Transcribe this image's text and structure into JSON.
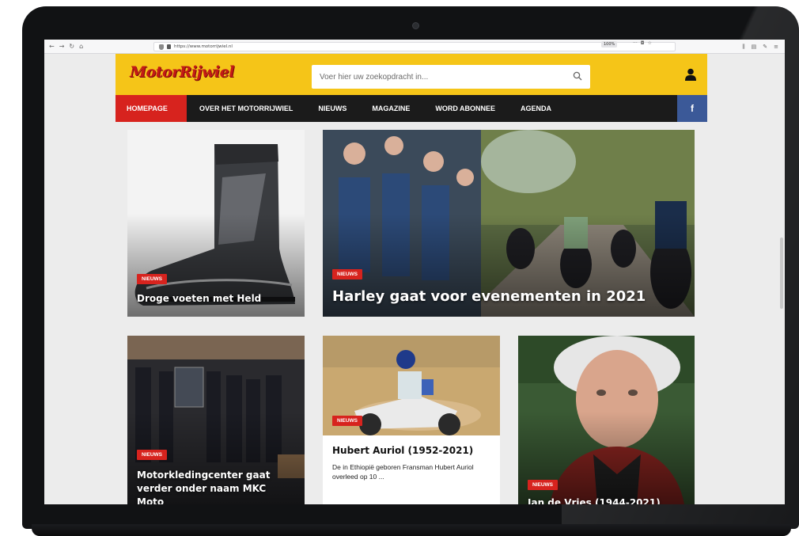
{
  "browser": {
    "url": "https://www.motorrijwiel.nl",
    "zoom": "100%"
  },
  "site": {
    "logo_text": "MotorRijwiel",
    "search_placeholder": "Voer hier uw zoekopdracht in...",
    "colors": {
      "header_yellow": "#f5c518",
      "nav_black": "#1b1b1b",
      "accent_red": "#d7231e",
      "facebook_blue": "#3b5998"
    }
  },
  "nav": {
    "items": [
      "HOMEPAGE",
      "OVER HET MOTORRIJWIEL",
      "NIEUWS",
      "MAGAZINE",
      "WORD ABONNEE",
      "AGENDA"
    ],
    "facebook_label": "f"
  },
  "articles": [
    {
      "badge": "NIEUWS",
      "title": "Droge voeten met Held"
    },
    {
      "badge": "NIEUWS",
      "title": "Harley gaat voor evenementen in 2021"
    },
    {
      "badge": "NIEUWS",
      "title": "Motorkledingcenter gaat verder onder naam MKC Moto"
    },
    {
      "badge": "NIEUWS",
      "title": "Hubert Auriol (1952-2021)",
      "excerpt": "De in Ethiopië geboren Fransman Hubert Auriol overleed op 10 ..."
    },
    {
      "badge": "NIEUWS",
      "title": "Jan de Vries (1944-2021)"
    }
  ]
}
